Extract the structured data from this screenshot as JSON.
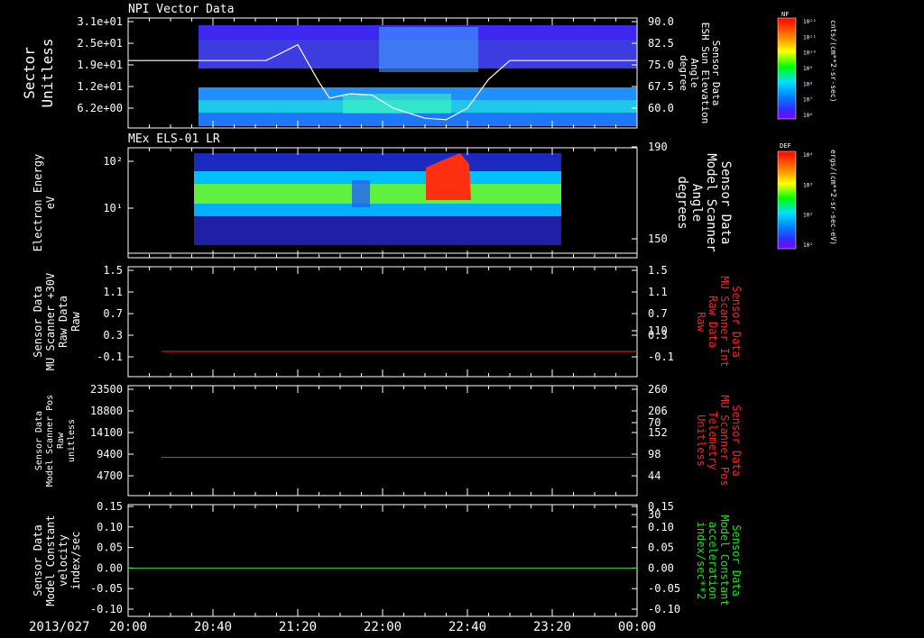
{
  "chart_data": [
    {
      "type": "heatmap",
      "title": "NPI Vector Data",
      "ylabel": [
        "Sector",
        "Unitless"
      ],
      "yticks": [
        "3.1e+01",
        "2.5e+01",
        "1.9e+01",
        "1.2e+01",
        "6.2e+00"
      ],
      "y2label": [
        "Sensor Data",
        "ESH Sun Elevation",
        "Angle",
        "degree"
      ],
      "y2ticks": [
        "90.0",
        "82.5",
        "75.0",
        "67.5",
        "60.0"
      ],
      "ylim": [
        3.1,
        31
      ],
      "y2lim": [
        52.5,
        90
      ],
      "colorbar": {
        "title": "NF",
        "label": "cnts/(cm**2-sr-sec)",
        "ticks": [
          "10¹²",
          "10¹¹",
          "10¹⁰",
          "10⁹",
          "10⁸",
          "10⁷",
          "10⁶"
        ]
      },
      "overlay_line": {
        "x": [
          "20:00",
          "20:20",
          "21:05",
          "21:12",
          "21:20",
          "21:30",
          "21:35",
          "21:45",
          "21:55",
          "22:05",
          "22:20",
          "22:30",
          "22:40",
          "22:50",
          "23:00",
          "00:00"
        ],
        "y": [
          76.5,
          76.5,
          76.5,
          79,
          82,
          69,
          63.5,
          65,
          64.5,
          60,
          56.5,
          56,
          60,
          70,
          76.5,
          76.5
        ]
      }
    },
    {
      "type": "heatmap",
      "title": "MEx ELS-01 LR",
      "ylabel": [
        "Electron Energy",
        "eV"
      ],
      "yticks": [
        "10²",
        "10¹"
      ],
      "y2label": [
        "Sensor Data",
        "Model Scanner",
        "Angle",
        "degrees"
      ],
      "y2ticks": [
        "190",
        "150",
        "110",
        "70",
        "30"
      ],
      "y2lim": [
        0,
        190
      ],
      "colorbar": {
        "title": "DEF",
        "label": "ergs/(cm**2-sr-sec-eV)",
        "ticks": [
          "10⁴",
          "10³",
          "10²",
          "10¹"
        ]
      },
      "overlay_line": {
        "x": [
          "20:00",
          "00:00"
        ],
        "y": [
          5,
          5
        ]
      }
    },
    {
      "type": "line",
      "ylabel": [
        "Sensor Data",
        "MU Scanner +30V",
        "Raw Data",
        "Raw"
      ],
      "yticks": [
        "1.5",
        "1.1",
        "0.7",
        "0.3",
        "-0.1"
      ],
      "y2label": [
        "Sensor Data",
        "MU Scanner Int",
        "Raw Data",
        "Raw"
      ],
      "y2ticks": [
        "1.5",
        "1.1",
        "0.7",
        "0.3",
        "-0.1"
      ],
      "ylim": [
        -0.4,
        1.5
      ],
      "series": [
        {
          "name": "MU Scanner Int",
          "x": [
            "20:20",
            "00:00"
          ],
          "y": [
            0,
            0
          ],
          "color": "#ff2020"
        }
      ]
    },
    {
      "type": "line",
      "ylabel": [
        "Sensor Data",
        "Model Scanner Pos",
        "Raw",
        "unitless"
      ],
      "yticks": [
        "23500",
        "18800",
        "14100",
        "9400",
        "4700"
      ],
      "y2label": [
        "Sensor Data",
        "MU Scanner Pos",
        "Telemetry",
        "Unitless"
      ],
      "y2ticks": [
        "260",
        "206",
        "152",
        "98",
        "44"
      ],
      "ylim": [
        0,
        23500
      ],
      "y2lim": [
        0,
        260
      ],
      "series": [
        {
          "name": "MU Scanner Pos",
          "x": [
            "20:20",
            "00:00"
          ],
          "y2": [
            90,
            90
          ],
          "color": "#ff2020"
        }
      ]
    },
    {
      "type": "line",
      "ylabel": [
        "Sensor Data",
        "Model Constant",
        "velocity",
        "index/sec"
      ],
      "yticks": [
        "0.15",
        "0.10",
        "0.05",
        "0.00",
        "-0.05",
        "-0.10"
      ],
      "y2label": [
        "Sensor Data",
        "Model Constant",
        "acceleration",
        "index/sec**2"
      ],
      "y2ticks": [
        "0.15",
        "0.10",
        "0.05",
        "0.00",
        "-0.05",
        "-0.10"
      ],
      "ylim": [
        -0.1,
        0.15
      ],
      "series": [
        {
          "name": "Model Constant acceleration",
          "x": [
            "20:00",
            "00:00"
          ],
          "y": [
            0,
            0
          ],
          "color": "#20e020"
        }
      ]
    }
  ],
  "xaxis": {
    "date": "2013/027",
    "ticks": [
      "20:00",
      "20:40",
      "21:20",
      "22:00",
      "22:40",
      "23:20",
      "00:00"
    ],
    "range": [
      "20:00",
      "00:00"
    ]
  },
  "colors": {
    "background": "#000000",
    "axes": "#ffffff",
    "red_trace": "#ff2020",
    "green_trace": "#20e020"
  }
}
